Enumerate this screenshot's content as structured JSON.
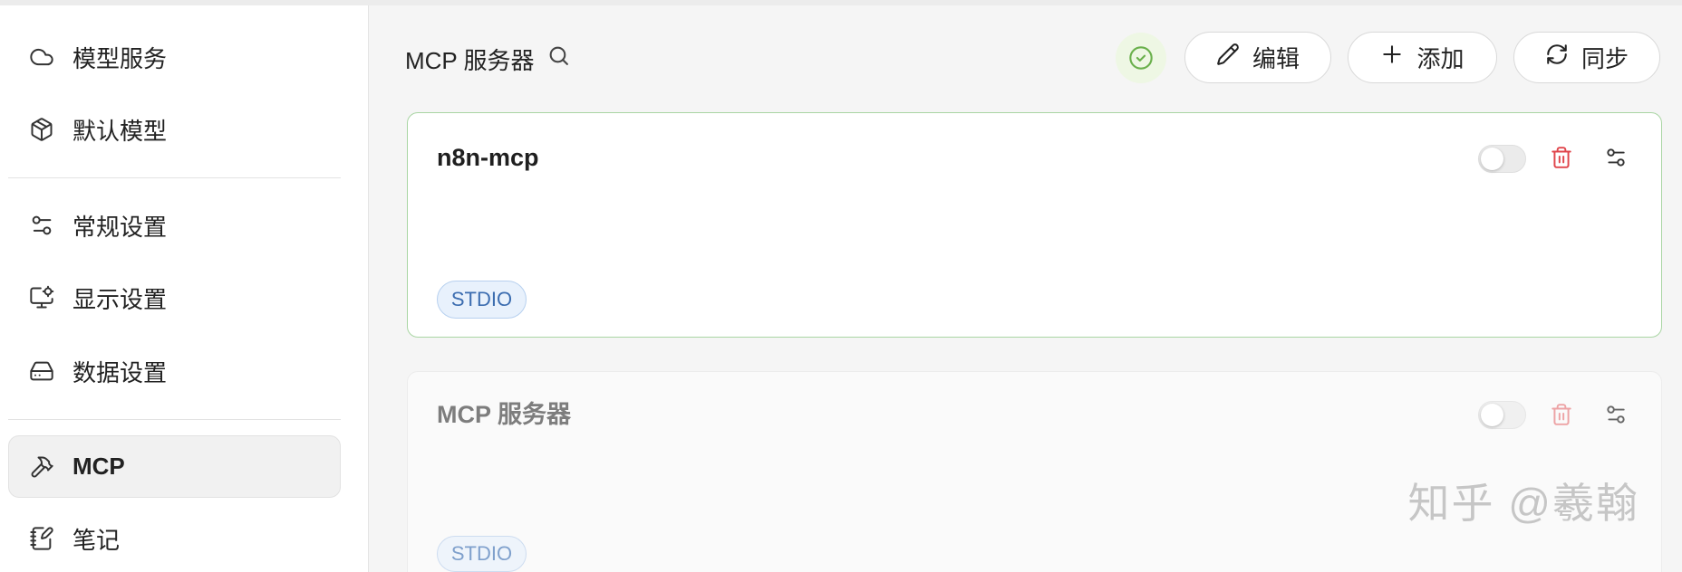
{
  "sidebar": {
    "items": [
      {
        "label": "模型服务",
        "icon": "cloud-icon"
      },
      {
        "label": "默认模型",
        "icon": "package-icon"
      },
      {
        "label": "常规设置",
        "icon": "sliders-icon"
      },
      {
        "label": "显示设置",
        "icon": "monitor-settings-icon"
      },
      {
        "label": "数据设置",
        "icon": "hard-drive-icon"
      },
      {
        "label": "MCP",
        "icon": "hammer-icon",
        "selected": true
      },
      {
        "label": "笔记",
        "icon": "notebook-pen-icon"
      }
    ]
  },
  "header": {
    "title": "MCP 服务器",
    "search_icon": "search-icon",
    "status_icon": "check-circle-icon",
    "buttons": [
      {
        "label": "编辑",
        "icon": "pencil-icon"
      },
      {
        "label": "添加",
        "icon": "plus-icon"
      },
      {
        "label": "同步",
        "icon": "refresh-icon"
      }
    ]
  },
  "servers": [
    {
      "name": "n8n-mcp",
      "type": "STDIO",
      "enabled": false,
      "active": true
    },
    {
      "name": "MCP 服务器",
      "type": "STDIO",
      "enabled": false,
      "active": false
    }
  ],
  "watermark": "知乎 @羲翰",
  "colors": {
    "accent_green": "#6ab04c",
    "active_card_border": "#a9d5a3",
    "danger": "#e0454b",
    "tag_text": "#3c6db0",
    "tag_bg": "#e8f1fc"
  }
}
